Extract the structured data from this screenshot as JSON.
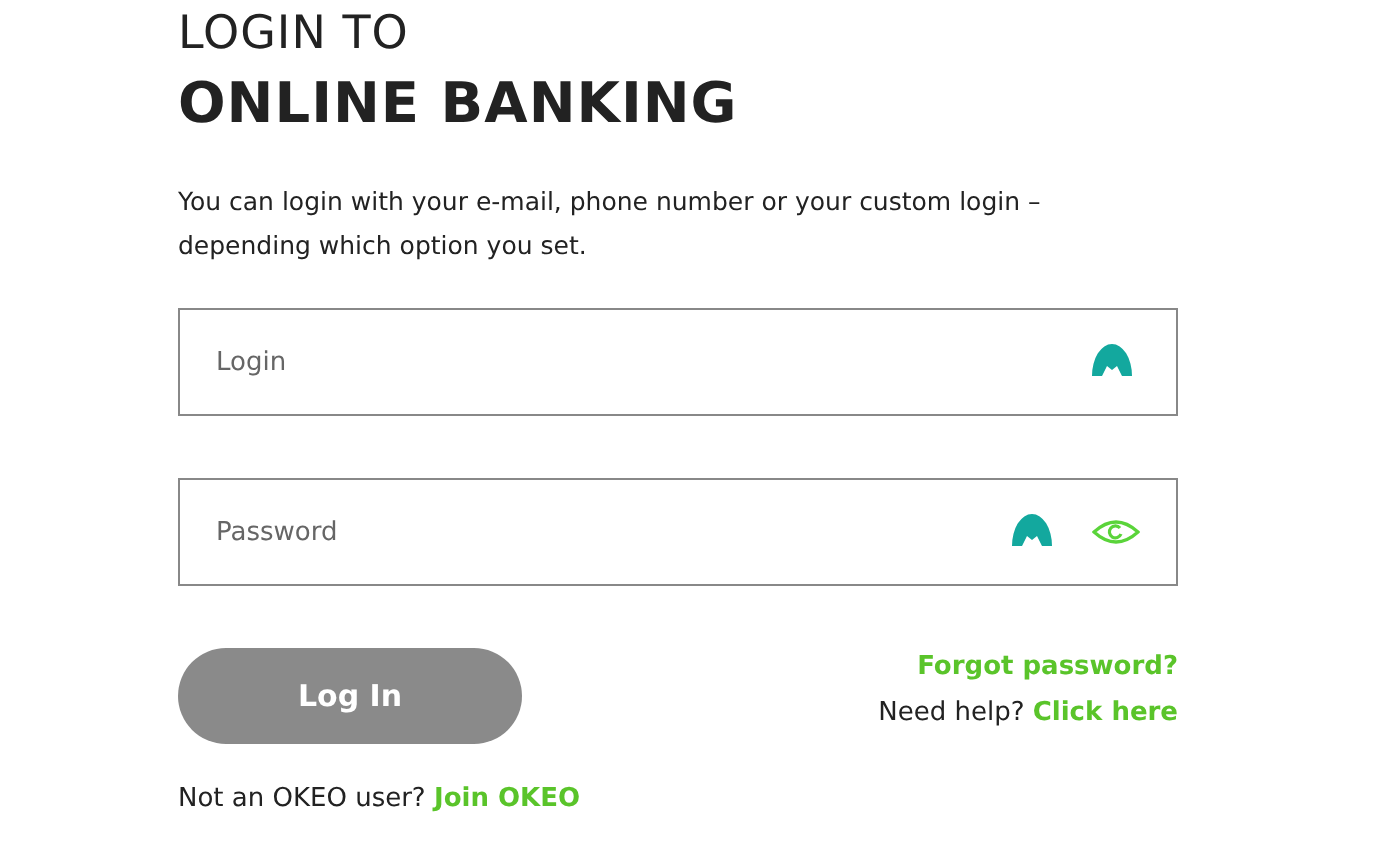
{
  "heading": {
    "line_1": "LOGIN TO",
    "line_2": "ONLINE BANKING"
  },
  "intro": "You can login with your e-mail, phone number or your custom login – depending which option you set.",
  "fields": [
    {
      "placeholder": "Login",
      "kind": "text"
    },
    {
      "placeholder": "Password",
      "kind": "password"
    }
  ],
  "login_button": "Log In",
  "forgot_link": "Forgot password?",
  "help": {
    "text": "Need help?",
    "link": "Click here"
  },
  "signup": {
    "text": "Not an OKEO user?",
    "link": "Join OKEO"
  }
}
